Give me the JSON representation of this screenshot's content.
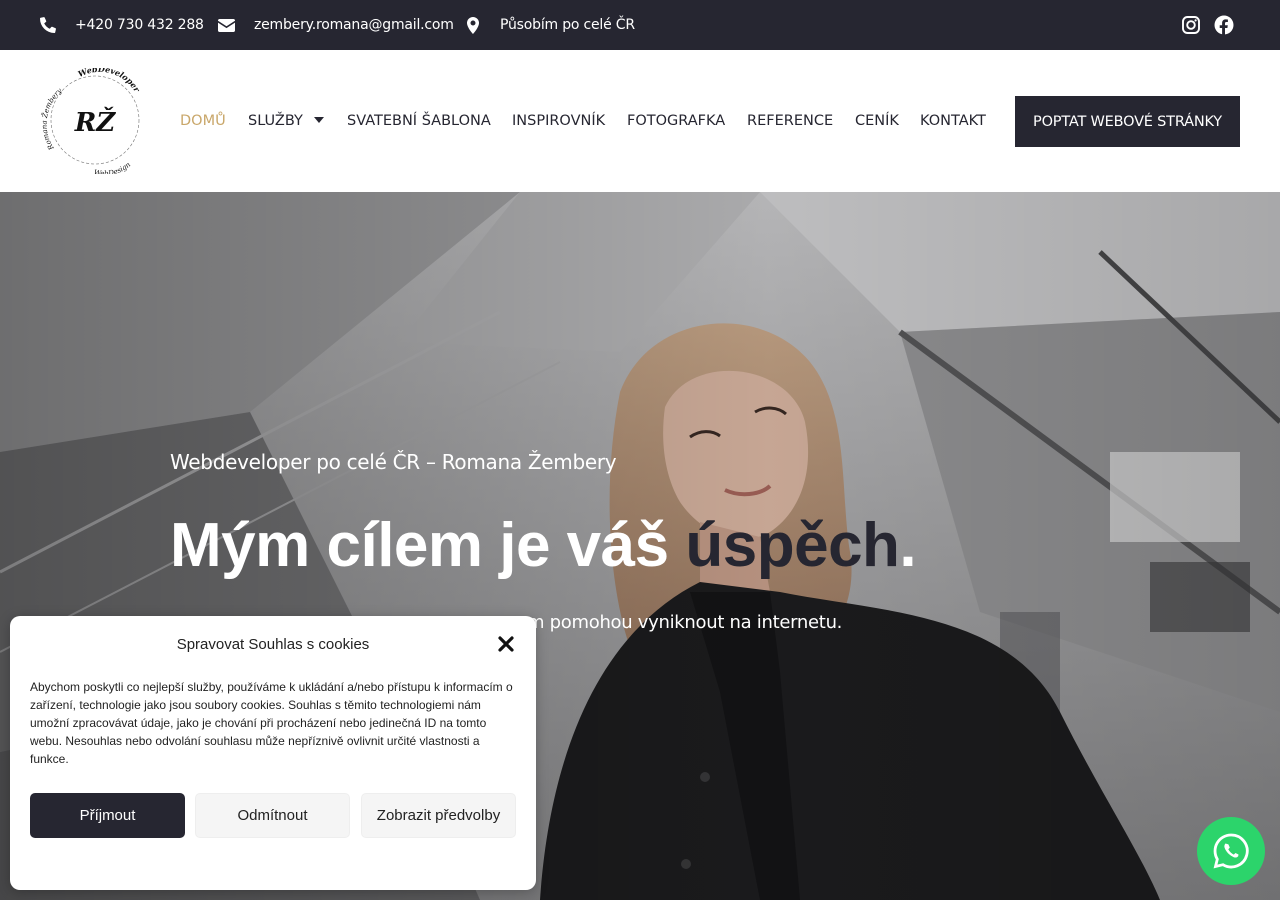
{
  "topbar": {
    "phone": "+420 730 432 288",
    "email": "zembery.romana@gmail.com",
    "location": "Působím po celé ČR",
    "phone_icon": "phone-icon",
    "email_icon": "envelope-icon",
    "location_icon": "map-pin-icon",
    "social": [
      "instagram-icon",
      "facebook-icon"
    ]
  },
  "header": {
    "logo": {
      "monogram": "RŽ",
      "ring_text_top": "WebDeveloper",
      "ring_text_left": "Romana Žembery",
      "ring_text_bottom": "WebDesign"
    },
    "nav": [
      {
        "label": "DOMŮ",
        "active": true
      },
      {
        "label": "SLUŽBY",
        "dropdown": true
      },
      {
        "label": "SVATEBNÍ ŠABLONA"
      },
      {
        "label": "INSPIROVNÍK"
      },
      {
        "label": "FOTOGRAFKA"
      },
      {
        "label": "REFERENCE"
      },
      {
        "label": "CENÍK"
      },
      {
        "label": "KONTAKT"
      }
    ],
    "cta": "POPTAT WEBOVÉ STRÁNKY"
  },
  "hero": {
    "subtitle": "Webdeveloper po celé ČR – Romana Žembery",
    "title_main": "Mým cílem je váš ",
    "title_accent": "úspěch",
    "title_end": ".",
    "description": "m pomohou vyniknout na internetu."
  },
  "cookie": {
    "title": "Spravovat Souhlas s cookies",
    "text": "Abychom poskytli co nejlepší služby, používáme k ukládání a/nebo přístupu k informacím o zařízení, technologie jako jsou soubory cookies. Souhlas s těmito technologiemi nám umožní zpracovávat údaje, jako je chování při procházení nebo jedinečná ID na tomto webu. Nesouhlas nebo odvolání souhlasu může nepříznivě ovlivnit určité vlastnosti a funkce.",
    "accept": "Příjmout",
    "deny": "Odmítnout",
    "prefs": "Zobrazit předvolby"
  },
  "colors": {
    "dark": "#262631",
    "accent_gold": "#c9a76a",
    "whatsapp": "#2cd46b"
  }
}
